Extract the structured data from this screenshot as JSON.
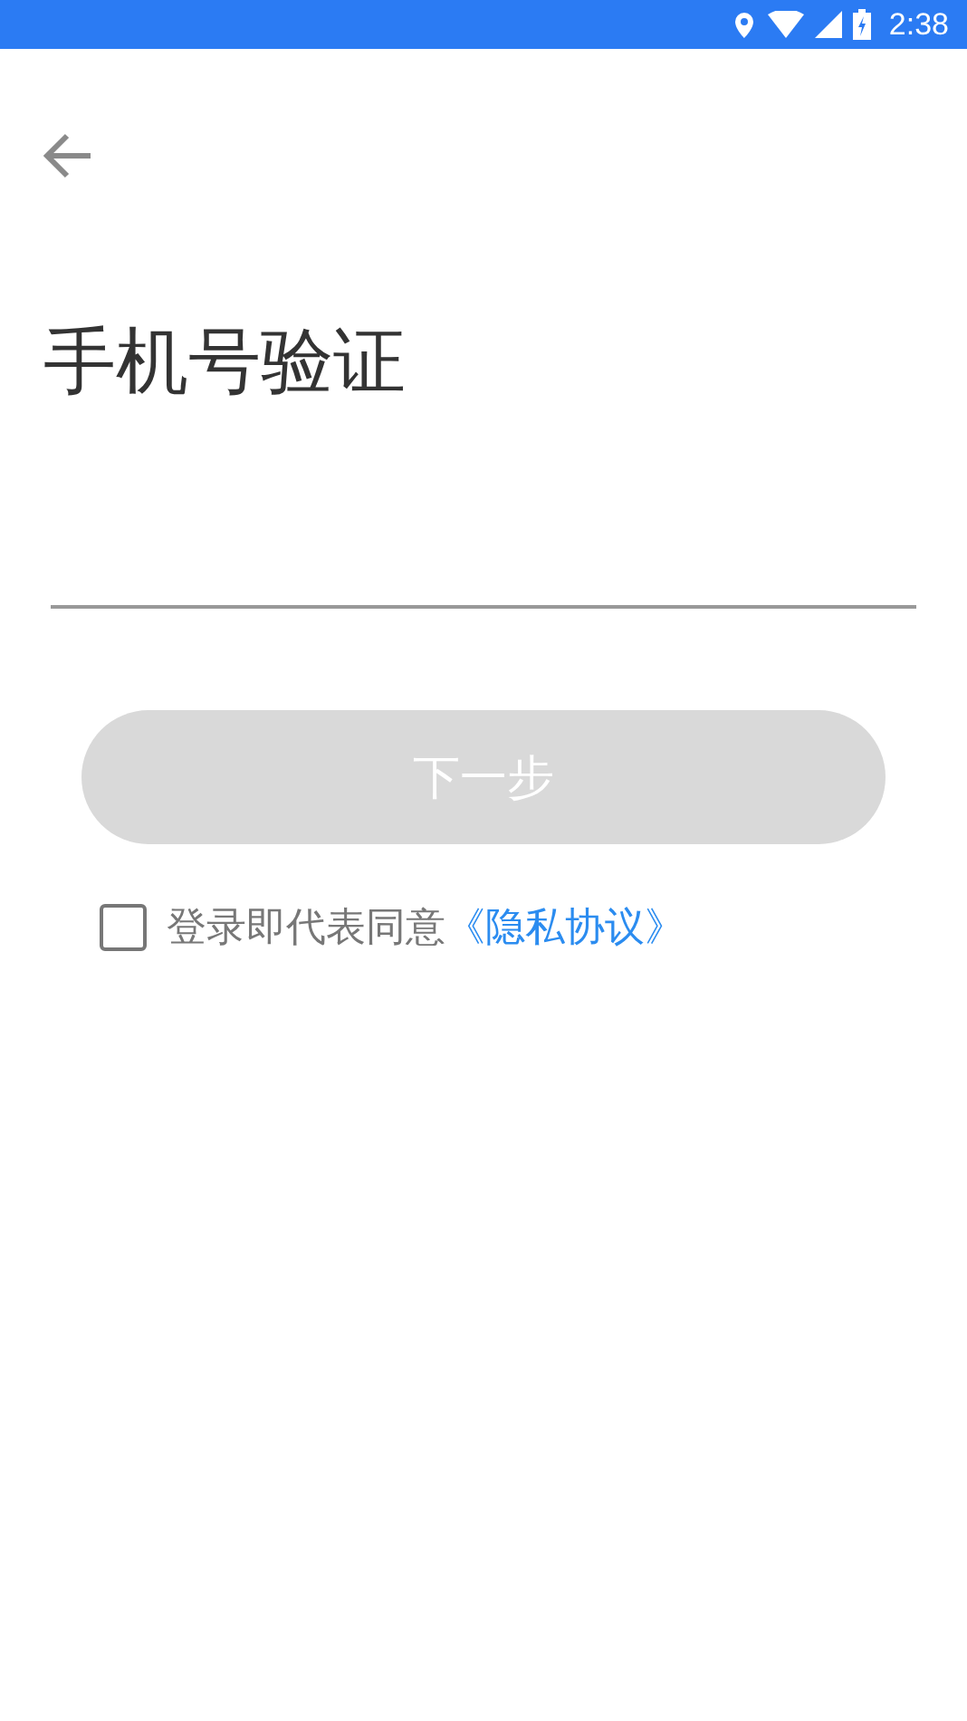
{
  "status_bar": {
    "time": "2:38"
  },
  "title": "手机号验证",
  "next_button": {
    "label": "下一步",
    "disabled": true
  },
  "agreement": {
    "checked": false,
    "text": "登录即代表同意",
    "link": "《隐私协议》"
  }
}
